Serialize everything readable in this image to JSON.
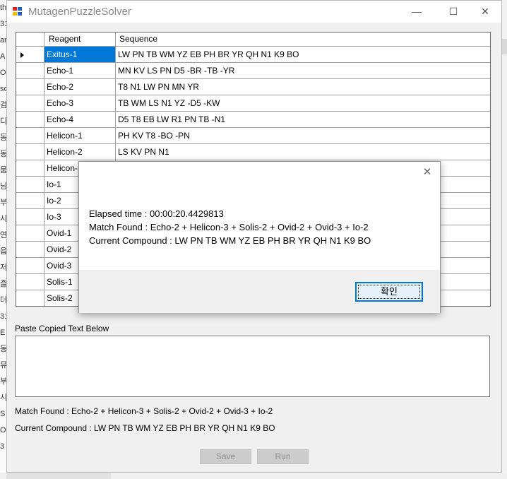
{
  "background": {
    "left_chars": [
      "th",
      "31",
      "ar",
      "A",
      "O",
      "so",
      "검",
      "디",
      "동",
      "동",
      "뭄",
      "님",
      "부",
      "시",
      "연",
      "읍",
      "저",
      "즐",
      "더",
      "31",
      "E",
      "동",
      "뮤",
      "부",
      "시",
      "S",
      "O",
      "3"
    ]
  },
  "window": {
    "title": "MutagenPuzzleSolver",
    "icon_colors": [
      "#e02020",
      "#1f5fc8",
      "#f2c200",
      "#1f5fc8"
    ],
    "minimize_glyph": "—",
    "maximize_glyph": "☐",
    "close_glyph": "✕"
  },
  "grid": {
    "columns": [
      "Reagent",
      "Sequence"
    ],
    "selected_row": 0,
    "selected_color": "#0078d7",
    "rows": [
      {
        "reagent": "Exitus-1",
        "sequence": "LW PN TB WM YZ EB PH BR YR QH N1 K9 BO"
      },
      {
        "reagent": "Echo-1",
        "sequence": "MN KV LS PN D5 -BR -TB -YR"
      },
      {
        "reagent": "Echo-2",
        "sequence": "T8 N1 LW PN MN YR"
      },
      {
        "reagent": "Echo-3",
        "sequence": "TB WM LS N1 YZ -D5 -KW"
      },
      {
        "reagent": "Echo-4",
        "sequence": "D5 T8 EB LW R1 PN TB -N1"
      },
      {
        "reagent": "Helicon-1",
        "sequence": "PH KV T8 -BO -PN"
      },
      {
        "reagent": "Helicon-2",
        "sequence": "LS KV PN N1"
      },
      {
        "reagent": "Helicon-",
        "sequence": ""
      },
      {
        "reagent": "Io-1",
        "sequence": ""
      },
      {
        "reagent": "Io-2",
        "sequence": ""
      },
      {
        "reagent": "Io-3",
        "sequence": ""
      },
      {
        "reagent": "Ovid-1",
        "sequence": ""
      },
      {
        "reagent": "Ovid-2",
        "sequence": ""
      },
      {
        "reagent": "Ovid-3",
        "sequence": ""
      },
      {
        "reagent": "Solis-1",
        "sequence": ""
      },
      {
        "reagent": "Solis-2",
        "sequence": ""
      }
    ]
  },
  "panel": {
    "paste_label": "Paste Copied Text Below",
    "paste_value": "",
    "match_found": "Match Found : Echo-2 + Helicon-3 + Solis-2 + Ovid-2 + Ovid-3 + Io-2",
    "current_compound": "Current Compound : LW PN TB WM YZ EB PH BR YR QH N1 K9 BO",
    "save_label": "Save",
    "run_label": "Run"
  },
  "dialog": {
    "close_glyph": "✕",
    "elapsed": "Elapsed time : 00:00:20.4429813",
    "match": "Match Found : Echo-2 + Helicon-3 + Solis-2 + Ovid-2 + Ovid-3 + Io-2",
    "compound": "Current Compound : LW PN TB WM YZ EB PH BR YR QH N1 K9 BO",
    "ok_label": "확인"
  }
}
